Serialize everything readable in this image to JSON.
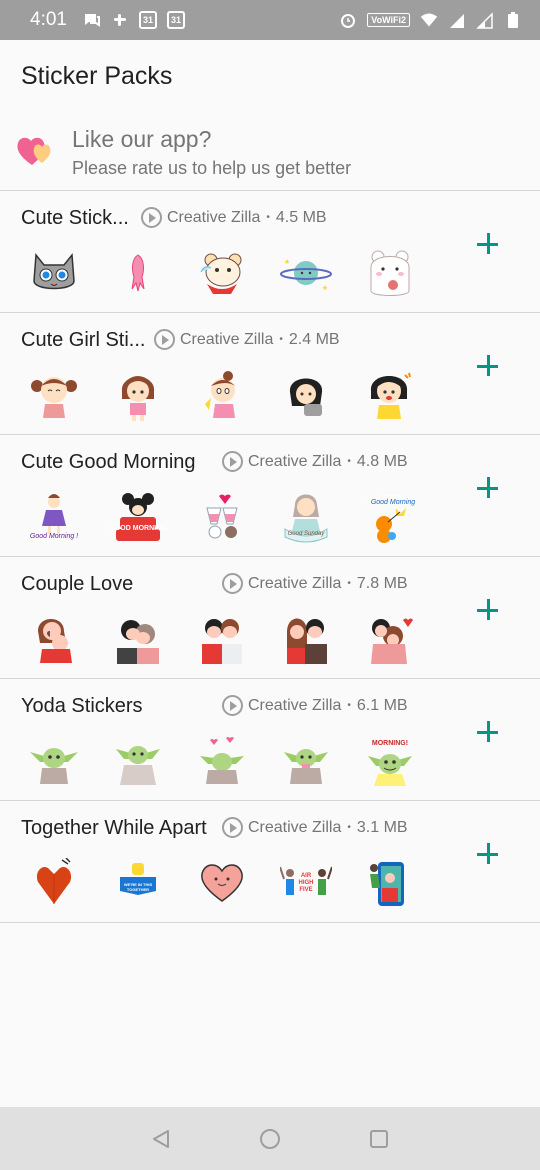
{
  "status": {
    "time": "4:01",
    "cal1": "31",
    "cal2": "31",
    "wifi_badge": "VoWiFi2"
  },
  "app": {
    "title": "Sticker Packs"
  },
  "rate": {
    "title": "Like our app?",
    "subtitle": "Please rate us to help us get better"
  },
  "packs": [
    {
      "name": "Cute Stick...",
      "publisher": "Creative Zilla",
      "size": "4.5 MB",
      "stickers": [
        "cat-face-sticker",
        "pink-squid-sticker",
        "bear-head-sticker",
        "planet-sticker",
        "bear-eating-sticker"
      ]
    },
    {
      "name": "Cute Girl Sti...",
      "publisher": "Creative Zilla",
      "size": "2.4 MB",
      "stickers": [
        "laughing-girl-sticker",
        "brown-hair-girl-sticker",
        "thinking-girl-sticker",
        "crying-girl-sticker",
        "excited-girl-sticker"
      ]
    },
    {
      "name": "Cute Good Morning",
      "publisher": "Creative Zilla",
      "size": "4.8 MB",
      "stickers": [
        "good-morning-girl-sticker",
        "good-morning-mouse-sticker",
        "drinks-cheers-sticker",
        "good-morning-couple-sticker",
        "good-morning-bear-sticker"
      ]
    },
    {
      "name": "Couple Love",
      "publisher": "Creative Zilla",
      "size": "7.8 MB",
      "stickers": [
        "couple-hug-sticker",
        "couple-kiss-sticker",
        "couple-cheek-sticker",
        "couple-smile-sticker",
        "couple-heart-sticker"
      ]
    },
    {
      "name": "Yoda Stickers",
      "publisher": "Creative Zilla",
      "size": "6.1 MB",
      "stickers": [
        "yoda-sticker",
        "yoda-robe-sticker",
        "yoda-hearts-sticker",
        "yoda-sipping-sticker",
        "yoda-morning-sticker"
      ]
    },
    {
      "name": "Together While Apart",
      "publisher": "Creative Zilla",
      "size": "3.1 MB",
      "stickers": [
        "paper-heart-sticker",
        "we-are-in-this-sticker",
        "smiling-heart-sticker",
        "air-high-five-sticker",
        "video-call-sticker"
      ]
    }
  ],
  "sticker_morning_text": "Good Morning",
  "sticker_morning_text_caps": "MORNING!",
  "sticker_good_morning_caps": "GOOD MORNING",
  "sticker_good_sunday": "Good Sunday",
  "sticker_air_high_five": "AIR HIGH FIVE",
  "sticker_we_are": "WE'RE IN THIS TOGETHER",
  "colors": {
    "accent": "#009688",
    "status_bar": "#9e9e9e",
    "nav_bar": "#e0e0e0"
  }
}
